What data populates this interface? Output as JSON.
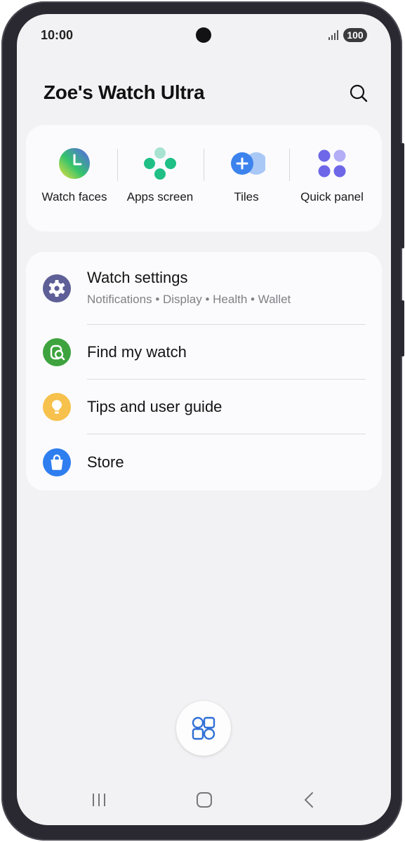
{
  "status_bar": {
    "time": "10:00",
    "battery": "100",
    "icons": [
      "camera-cutout",
      "signal-icon",
      "battery-icon"
    ]
  },
  "header": {
    "title": "Zoe's Watch Ultra",
    "search_icon": "search-icon"
  },
  "quick_actions": [
    {
      "label": "Watch faces",
      "icon": "watch-faces-icon"
    },
    {
      "label": "Apps screen",
      "icon": "apps-screen-icon"
    },
    {
      "label": "Tiles",
      "icon": "tiles-icon"
    },
    {
      "label": "Quick panel",
      "icon": "quick-panel-icon"
    }
  ],
  "menu": [
    {
      "title": "Watch settings",
      "subtitle": "Notifications • Display • Health • Wallet",
      "icon": "gear-icon",
      "color": "#5e5f97"
    },
    {
      "title": "Find my watch",
      "icon": "find-watch-icon",
      "color": "#3ea33e"
    },
    {
      "title": "Tips and user guide",
      "icon": "lightbulb-icon",
      "color": "#f6c14c"
    },
    {
      "title": "Store",
      "icon": "shopping-bag-icon",
      "color": "#2e7ef0"
    }
  ],
  "fab": {
    "icon": "grid-shapes-icon",
    "color": "#2f6fd6"
  },
  "navigation_bar": {
    "icons": [
      "recents-icon",
      "home-icon",
      "back-icon"
    ]
  },
  "colors": {
    "background": "#f2f2f4",
    "card": "#fbfbfd",
    "accent": "#2f6fd6"
  }
}
